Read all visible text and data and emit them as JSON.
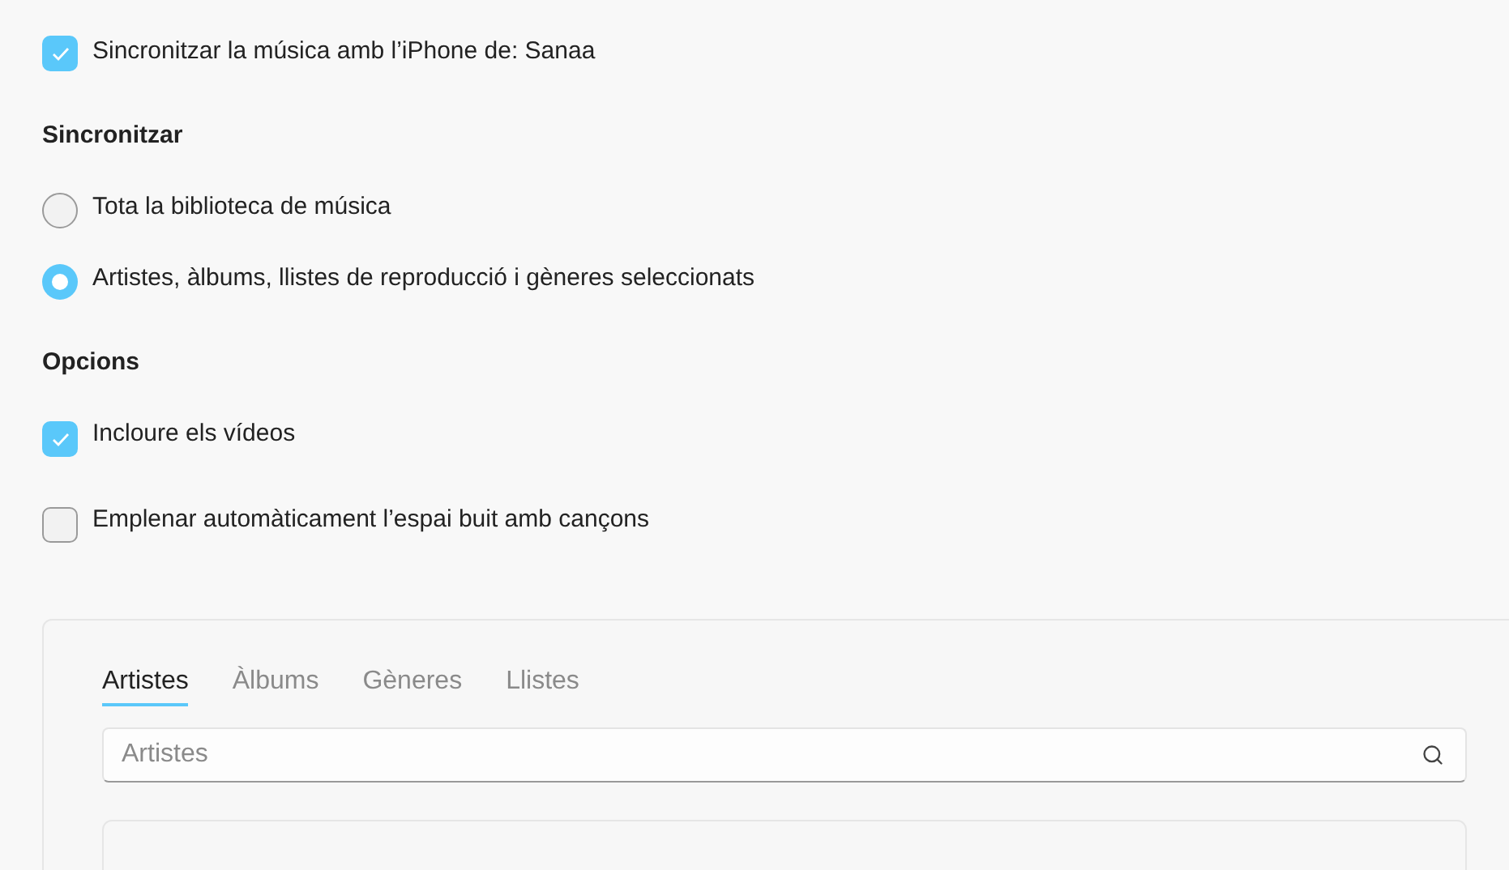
{
  "sync_checkbox": {
    "label": "Sincronitzar la música amb l’iPhone de: Sanaa",
    "checked": true
  },
  "sync_section": {
    "heading": "Sincronitzar",
    "options": [
      {
        "label": "Tota la biblioteca de música",
        "selected": false
      },
      {
        "label": "Artistes, àlbums, llistes de reproducció i gèneres seleccionats",
        "selected": true
      }
    ]
  },
  "options_section": {
    "heading": "Opcions",
    "checkboxes": [
      {
        "label": "Incloure els vídeos",
        "checked": true
      },
      {
        "label": "Emplenar automàticament l’espai buit amb cançons",
        "checked": false
      }
    ]
  },
  "browser": {
    "tabs": [
      {
        "label": "Artistes",
        "selected": true
      },
      {
        "label": "Àlbums",
        "selected": false
      },
      {
        "label": "Gèneres",
        "selected": false
      },
      {
        "label": "Llistes",
        "selected": false
      }
    ],
    "search": {
      "placeholder": "Artistes"
    }
  }
}
